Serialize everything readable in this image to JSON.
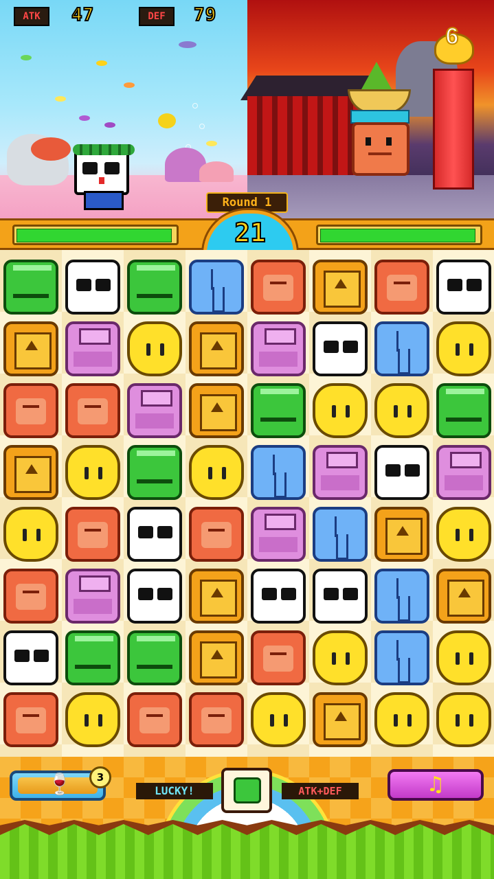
{
  "hud": {
    "atk_label": "ATK",
    "atk_value": "47",
    "def_label": "DEF",
    "def_value": "79",
    "round_label": "Round 1",
    "timer": "21",
    "trophy_number": "6"
  },
  "player_hp": 1.0,
  "enemy_hp": 1.0,
  "board": {
    "rows": [
      [
        "frog",
        "panda",
        "frog",
        "elephant",
        "monkey",
        "lion",
        "monkey",
        "panda"
      ],
      [
        "lion",
        "hippo",
        "giraffe",
        "lion",
        "hippo",
        "panda",
        "elephant",
        "giraffe"
      ],
      [
        "monkey",
        "monkey",
        "hippo",
        "lion",
        "frog",
        "giraffe",
        "giraffe",
        "frog"
      ],
      [
        "lion",
        "giraffe",
        "frog",
        "giraffe",
        "elephant",
        "hippo",
        "panda",
        "hippo"
      ],
      [
        "giraffe",
        "monkey",
        "panda",
        "monkey",
        "hippo",
        "elephant",
        "lion",
        "giraffe"
      ],
      [
        "monkey",
        "hippo",
        "panda",
        "lion",
        "panda",
        "panda",
        "elephant",
        "lion"
      ],
      [
        "panda",
        "frog",
        "frog",
        "lion",
        "monkey",
        "giraffe",
        "elephant",
        "giraffe"
      ],
      [
        "monkey",
        "giraffe",
        "monkey",
        "monkey",
        "giraffe",
        "lion",
        "giraffe",
        "giraffe"
      ]
    ]
  },
  "footer": {
    "item_count": "3",
    "item_icon": "wine-glass-icon",
    "lucky_label": "LUCKY!",
    "lucky_animal": "frog",
    "effect_label": "ATK+DEF",
    "music_icon": "music-note-icon",
    "music_glyph": "♫"
  },
  "colors": {
    "frame_orange": "#f3a219",
    "hp_green": "#31d631",
    "timer_bg": "#2dcbf0"
  }
}
